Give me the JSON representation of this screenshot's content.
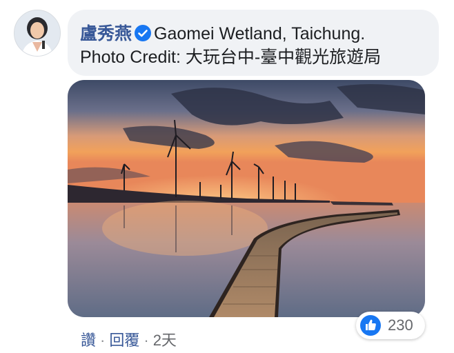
{
  "comment": {
    "author": "盧秀燕",
    "text_line1": "Gaomei Wetland, Taichung.",
    "text_line2": "Photo Credit: 大玩台中-臺中觀光旅遊局"
  },
  "icons": {
    "avatar": "profile-photo",
    "verified": "verified-badge-icon",
    "like": "thumbs-up-icon"
  },
  "actions": {
    "like_label": "讚",
    "reply_label": "回覆",
    "time": "2天"
  },
  "reactions": {
    "count": "230"
  },
  "colors": {
    "author": "#385898",
    "verified": "#1877f2",
    "like": "#1877f2",
    "bubble": "#f0f2f5"
  }
}
